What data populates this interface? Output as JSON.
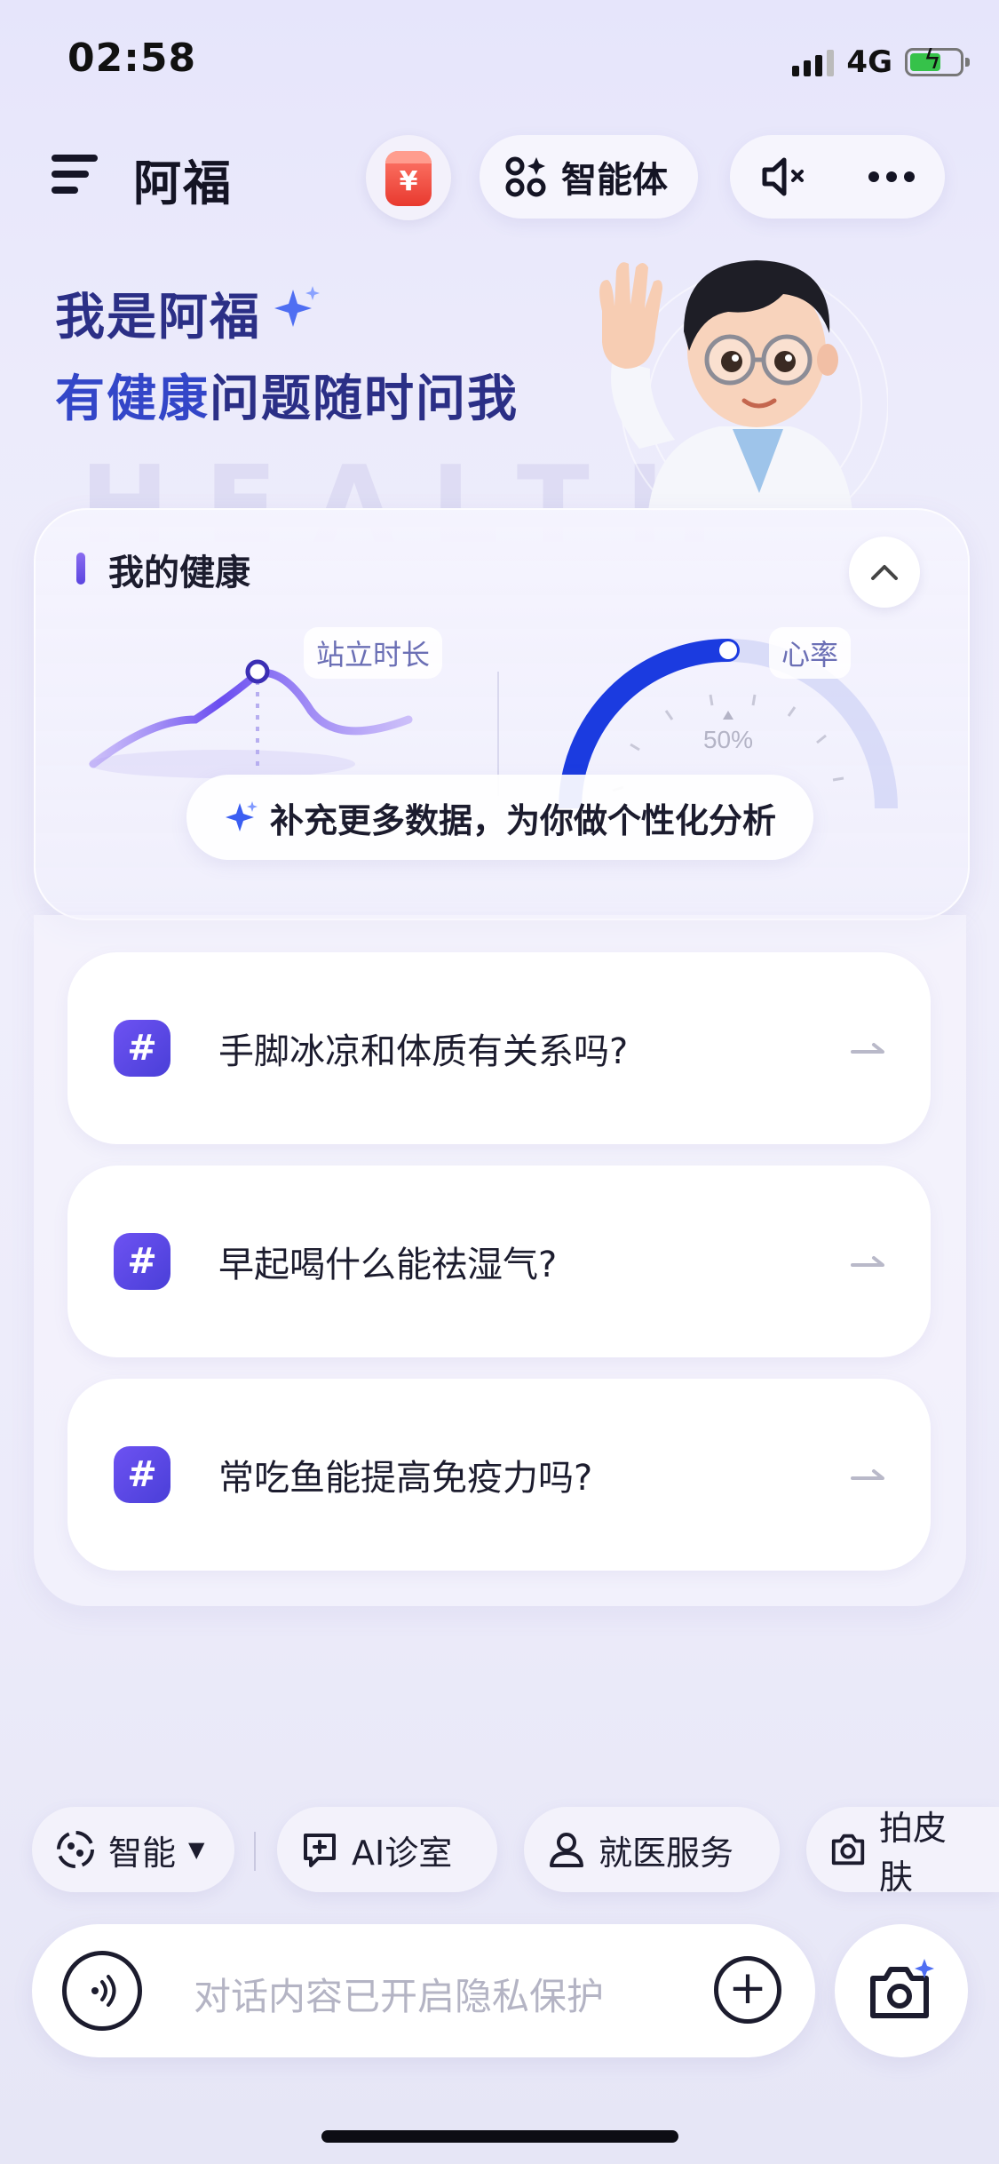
{
  "status_bar": {
    "time": "02:58",
    "network": "4G"
  },
  "header": {
    "app_name": "阿福",
    "agent_label": "智能体"
  },
  "hero": {
    "line1": "我是阿福",
    "line2_part1": "有健康",
    "line2_part2": "问题随时问我"
  },
  "health_card": {
    "title": "我的健康",
    "stand_label": "站立时长",
    "heart_label": "心率",
    "gauge_percent_text": "50%",
    "gauge_value": 0.5,
    "supplement_text": "补充更多数据，为你做个性化分析"
  },
  "questions": [
    {
      "icon": "#",
      "text": "手脚冰凉和体质有关系吗?"
    },
    {
      "icon": "#",
      "text": "早起喝什么能祛湿气?"
    },
    {
      "icon": "#",
      "text": "常吃鱼能提高免疫力吗?"
    }
  ],
  "chips": {
    "mode": "智能",
    "clinic": "AI诊室",
    "medical": "就医服务",
    "skin": "拍皮肤"
  },
  "input": {
    "placeholder": "对话内容已开启隐私保护"
  },
  "colors": {
    "accent": "#4a3fd8",
    "hero_dark": "#2b2f86",
    "hero_blue": "#3346c8",
    "gauge_blue": "#1b3be0"
  }
}
